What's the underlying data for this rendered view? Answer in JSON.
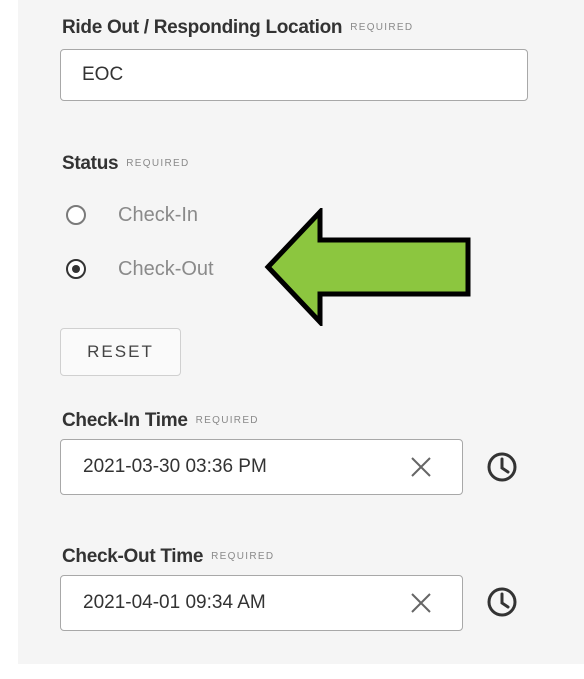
{
  "location": {
    "label": "Ride Out / Responding Location",
    "required": "REQUIRED",
    "value": "EOC"
  },
  "status": {
    "label": "Status",
    "required": "REQUIRED",
    "options": [
      {
        "label": "Check-In",
        "checked": false
      },
      {
        "label": "Check-Out",
        "checked": true
      }
    ],
    "reset_label": "RESET"
  },
  "check_in": {
    "label": "Check-In Time",
    "required": "REQUIRED",
    "value": "2021-03-30 03:36 PM",
    "clear_icon": "close-icon",
    "picker_icon": "clock-icon"
  },
  "check_out": {
    "label": "Check-Out Time",
    "required": "REQUIRED",
    "value": "2021-04-01 09:34 AM",
    "clear_icon": "close-icon",
    "picker_icon": "clock-icon"
  },
  "colors": {
    "panel_bg": "#f5f5f5",
    "arrow_fill": "#8cc63f",
    "arrow_stroke": "#000000"
  }
}
